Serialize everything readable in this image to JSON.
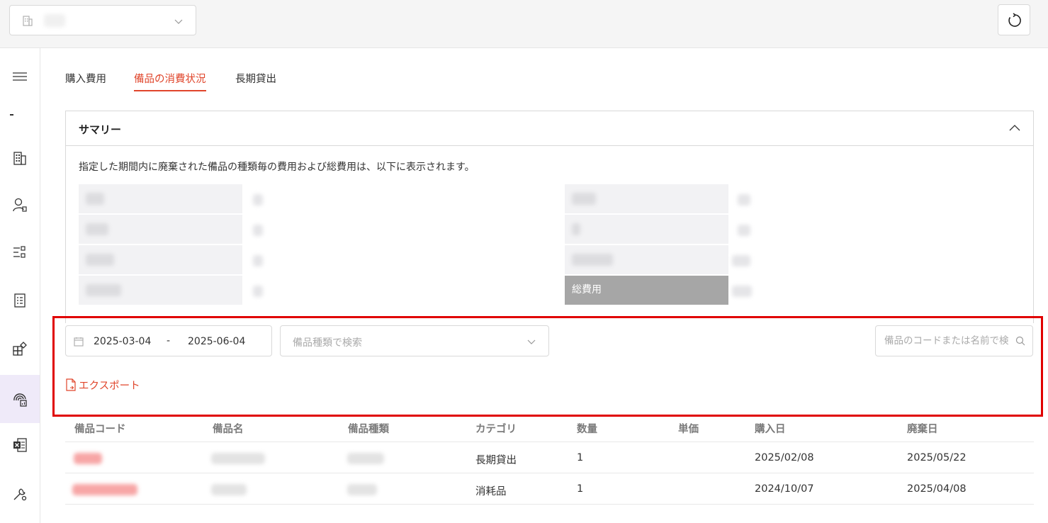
{
  "header": {
    "org_select_icon": "building-icon",
    "refresh_icon": "refresh-icon"
  },
  "sidebar": {
    "items": [
      {
        "icon": "menu-icon"
      },
      {
        "icon": "building-icon"
      },
      {
        "icon": "user-badge-icon"
      },
      {
        "icon": "list-settings-icon"
      },
      {
        "icon": "checklist-document-icon"
      },
      {
        "icon": "add-block-icon"
      },
      {
        "icon": "fingerprint-chart-icon",
        "active": true
      },
      {
        "icon": "excel-icon"
      },
      {
        "icon": "tools-icon"
      }
    ]
  },
  "tabs": [
    {
      "label": "購入費用",
      "active": false
    },
    {
      "label": "備品の消費状況",
      "active": true
    },
    {
      "label": "長期貸出",
      "active": false
    }
  ],
  "summary": {
    "title": "サマリー",
    "description": "指定した期間内に廃棄された備品の種類毎の費用および総費用は、以下に表示されます。",
    "total_label": "総費用"
  },
  "filters": {
    "date_start": "2025-03-04",
    "date_separator": "-",
    "date_end": "2025-06-04",
    "type_placeholder": "備品種類で検索",
    "search_placeholder": "備品のコードまたは名前で検索"
  },
  "export": {
    "label": "エクスポート"
  },
  "table": {
    "columns": [
      "備品コード",
      "備品名",
      "備品種類",
      "カテゴリ",
      "数量",
      "単価",
      "購入日",
      "廃棄日"
    ],
    "rows": [
      {
        "category": "長期貸出",
        "quantity": "1",
        "purchase_date": "2025/02/08",
        "disposal_date": "2025/05/22"
      },
      {
        "category": "消耗品",
        "quantity": "1",
        "purchase_date": "2024/10/07",
        "disposal_date": "2025/04/08"
      }
    ]
  },
  "colors": {
    "accent": "#e0452b",
    "highlight_border": "#e00000",
    "active_sidebar_bg": "#efeaf9"
  }
}
